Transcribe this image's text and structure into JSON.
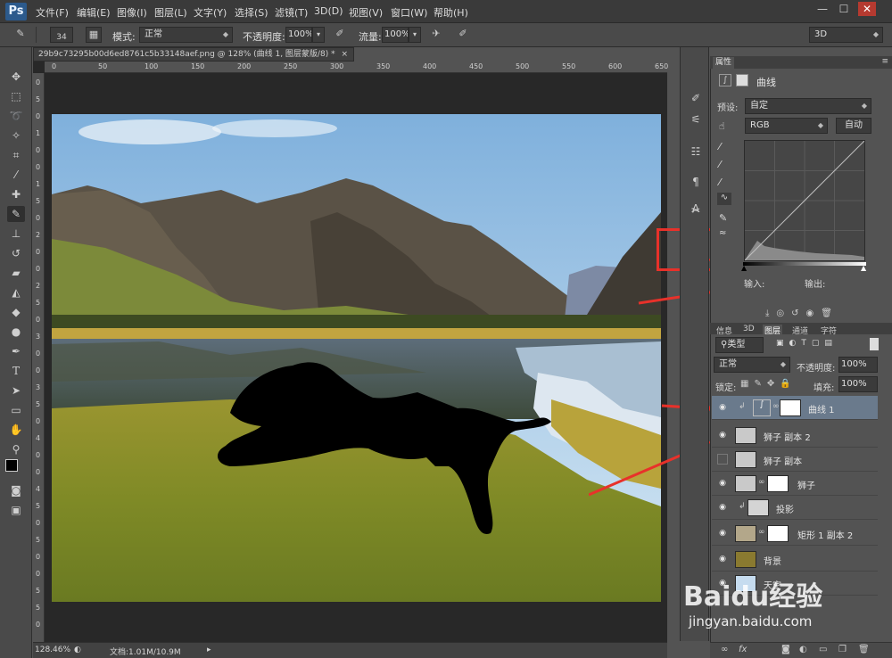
{
  "app": {
    "logo": "Ps"
  },
  "menu": [
    "文件(F)",
    "编辑(E)",
    "图像(I)",
    "图层(L)",
    "文字(Y)",
    "选择(S)",
    "滤镜(T)",
    "3D(D)",
    "视图(V)",
    "窗口(W)",
    "帮助(H)"
  ],
  "window_controls": {
    "minimize": "—",
    "maximize": "☐",
    "close": "✕"
  },
  "options": {
    "brush_size": "34",
    "mode_label": "模式:",
    "mode_value": "正常",
    "opacity_label": "不透明度:",
    "opacity_value": "100%",
    "flow_label": "流量:",
    "flow_value": "100%",
    "workspace": "3D"
  },
  "document": {
    "tab_title": "29b9c73295b00d6ed8761c5b33148aef.png @ 128% (曲线 1, 图层蒙版/8) *",
    "ruler_top": [
      "0",
      "50",
      "100",
      "150",
      "200",
      "250",
      "300",
      "350",
      "400",
      "450",
      "500",
      "550",
      "600",
      "650"
    ],
    "ruler_left": [
      "0",
      "5",
      "0",
      "1",
      "0",
      "0",
      "1",
      "5",
      "0",
      "2",
      "0",
      "0",
      "2",
      "5",
      "0",
      "3",
      "0",
      "0",
      "3",
      "5",
      "0",
      "4",
      "0",
      "0",
      "4",
      "5",
      "0",
      "5",
      "0",
      "0",
      "5",
      "5",
      "0"
    ]
  },
  "status": {
    "zoom": "128.46%",
    "doc_info": "文档:1.01M/10.9M"
  },
  "properties": {
    "tab": "属性",
    "title": "曲线",
    "preset_label": "预设:",
    "preset_value": "自定",
    "channel": "RGB",
    "auto_button": "自动",
    "input_label": "输入:",
    "output_label": "输出:"
  },
  "layers_panel": {
    "tabs": [
      "信息",
      "3D",
      "图层",
      "通道",
      "字符"
    ],
    "filter_kind": "类型",
    "blend_mode": "正常",
    "opacity_label": "不透明度:",
    "opacity_value": "100%",
    "lock_label": "锁定:",
    "fill_label": "填充:",
    "fill_value": "100%",
    "layers": [
      {
        "name": "曲线 1",
        "visible": true,
        "selected": true
      },
      {
        "name": "狮子 副本 2",
        "visible": true,
        "selected": false
      },
      {
        "name": "狮子 副本",
        "visible": false,
        "selected": false
      },
      {
        "name": "狮子",
        "visible": true,
        "selected": false
      },
      {
        "name": "投影",
        "visible": true,
        "selected": false
      },
      {
        "name": "矩形 1 副本 2",
        "visible": true,
        "selected": false
      },
      {
        "name": "背景",
        "visible": true,
        "selected": false
      },
      {
        "name": "天空",
        "visible": true,
        "selected": false
      }
    ],
    "footer_icons": [
      "link-icon",
      "fx-icon",
      "mask-icon",
      "adjustment-icon",
      "group-icon",
      "new-layer-icon",
      "trash-icon"
    ]
  },
  "watermark": {
    "brand": "Baidu经验",
    "url": "jingyan.baidu.com"
  },
  "colors": {
    "annotation_red": "#e8312a",
    "selected_layer": "#6a7a8c",
    "panel_bg": "#535353"
  }
}
